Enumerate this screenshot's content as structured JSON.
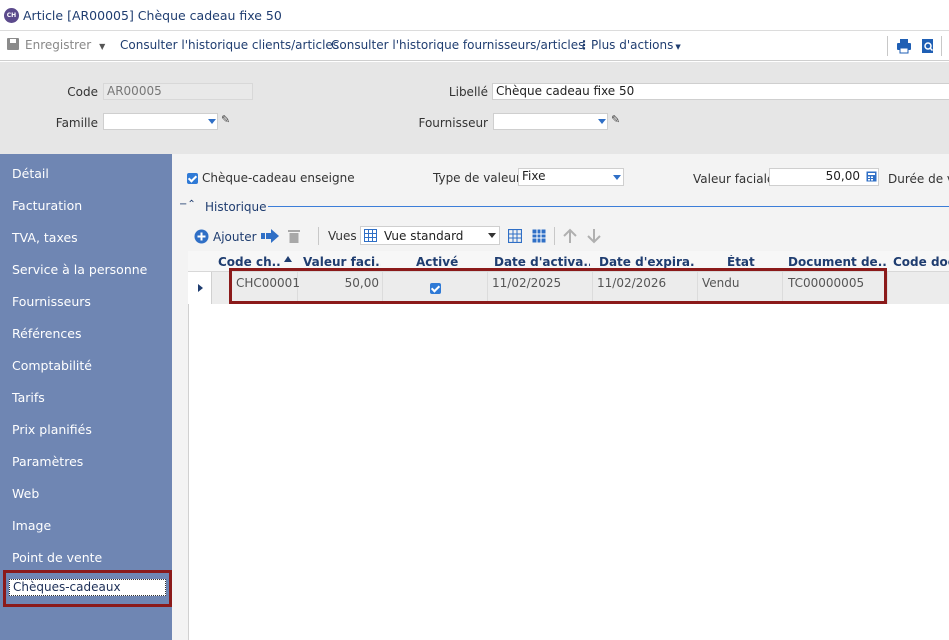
{
  "window": {
    "icon_text": "CH",
    "title": "Article [AR00005] Chèque cadeau fixe 50"
  },
  "toolbar": {
    "save_label": "Enregistrer",
    "history_clients_label": "Consulter l'historique clients/articles",
    "history_suppliers_label": "Consulter l'historique fournisseurs/articles",
    "more_actions_label": "Plus d'actions"
  },
  "header": {
    "code_label": "Code",
    "code_value": "AR00005",
    "libelle_label": "Libellé",
    "libelle_value": "Chèque cadeau fixe 50",
    "famille_label": "Famille",
    "famille_value": "",
    "fournisseur_label": "Fournisseur",
    "fournisseur_value": ""
  },
  "sidebar": {
    "items": [
      {
        "label": "Détail"
      },
      {
        "label": "Facturation"
      },
      {
        "label": "TVA, taxes"
      },
      {
        "label": "Service à la personne"
      },
      {
        "label": "Fournisseurs"
      },
      {
        "label": "Références"
      },
      {
        "label": "Comptabilité"
      },
      {
        "label": "Tarifs"
      },
      {
        "label": "Prix planifiés"
      },
      {
        "label": "Paramètres"
      },
      {
        "label": "Web"
      },
      {
        "label": "Image"
      },
      {
        "label": "Point de vente"
      }
    ],
    "active_label": "Chèques-cadeaux"
  },
  "main": {
    "enseigne_label": "Chèque-cadeau enseigne",
    "enseigne_checked": true,
    "type_valeur_label": "Type de valeur",
    "type_valeur_value": "Fixe",
    "valeur_faciale_label": "Valeur faciale",
    "valeur_faciale_value": "50,00",
    "duree_label": "Durée de v",
    "section_label": "Historique"
  },
  "grid_toolbar": {
    "add_label": "Ajouter",
    "views_label": "Vues",
    "view_value": "Vue standard"
  },
  "grid": {
    "columns": [
      "Code ch...",
      "Valeur faci...",
      "Activé",
      "Date d'activa...",
      "Date d'expira...",
      "État",
      "Document de...",
      "Code doc"
    ],
    "rows": [
      {
        "code": "CHC00001",
        "valeur": "50,00",
        "active": true,
        "date_activation": "11/02/2025",
        "date_expiration": "11/02/2026",
        "etat": "Vendu",
        "document": "TC00000005",
        "code_doc": ""
      }
    ]
  },
  "colors": {
    "sidebar_bg": "#6f86b3",
    "highlight_border": "#8b1a1a",
    "accent_blue": "#2f7ad6",
    "text_navy": "#1f3d70"
  }
}
